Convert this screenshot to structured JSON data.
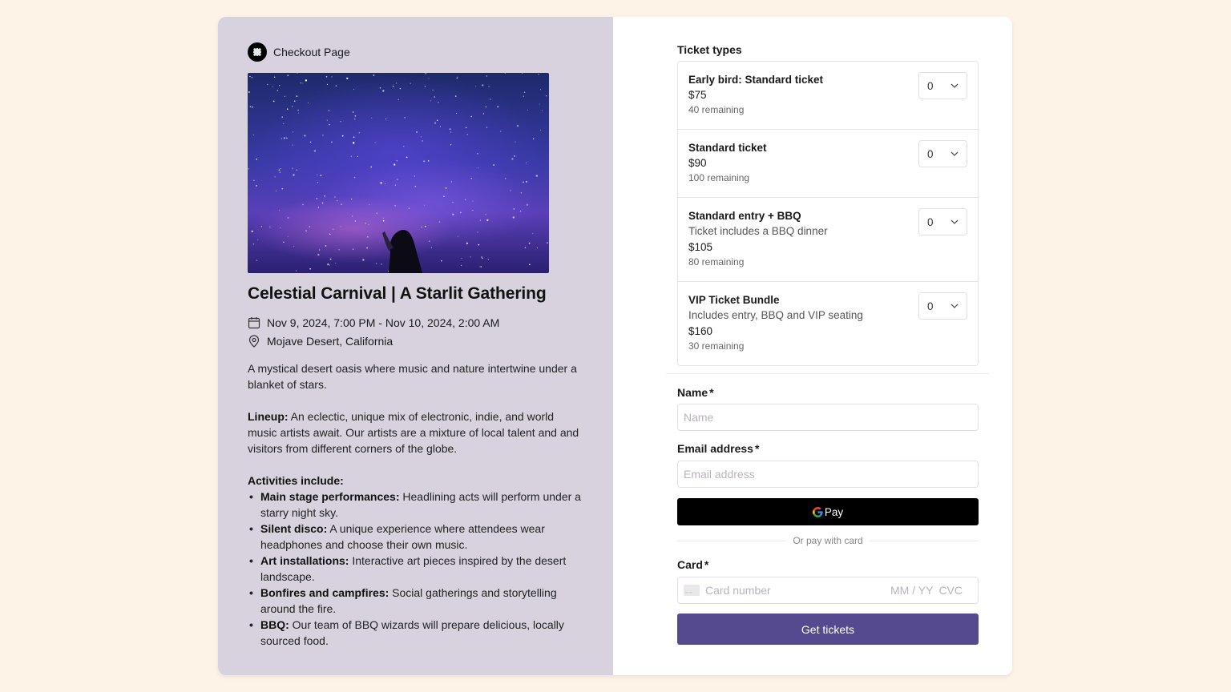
{
  "brand": {
    "name": "Checkout Page",
    "logo_icon": "brand-logo-icon"
  },
  "event": {
    "title": "Celestial Carnival | A Starlit Gathering",
    "datetime": "Nov 9, 2024, 7:00 PM - Nov 10, 2024, 2:00 AM",
    "location": "Mojave Desert, California",
    "intro": "A mystical desert oasis where music and nature intertwine under a blanket of stars.",
    "lineup_label": "Lineup:",
    "lineup_text": " An eclectic, unique mix of electronic, indie, and world music artists await. Our artists are a mixture of local talent and and visitors from different corners of the globe.",
    "activities_label": "Activities include:",
    "activities": [
      {
        "title": "Main stage performances:",
        "text": " Headlining acts will perform under a starry night sky."
      },
      {
        "title": "Silent disco:",
        "text": " A unique experience where attendees wear headphones and choose their own music."
      },
      {
        "title": "Art installations:",
        "text": " Interactive art pieces inspired by the desert landscape."
      },
      {
        "title": "Bonfires and campfires:",
        "text": " Social gatherings and storytelling around the fire."
      },
      {
        "title": "BBQ:",
        "text": " Our team of BBQ wizards will prepare delicious, locally sourced food."
      }
    ]
  },
  "tickets": {
    "label": "Ticket types",
    "items": [
      {
        "name": "Early bird: Standard ticket",
        "description": null,
        "price": "$75",
        "remaining": "40 remaining",
        "quantity": "0"
      },
      {
        "name": "Standard ticket",
        "description": null,
        "price": "$90",
        "remaining": "100 remaining",
        "quantity": "0"
      },
      {
        "name": "Standard entry + BBQ",
        "description": "Ticket includes a BBQ dinner",
        "price": "$105",
        "remaining": "80 remaining",
        "quantity": "0"
      },
      {
        "name": "VIP Ticket Bundle",
        "description": "Includes entry, BBQ and VIP seating",
        "price": "$160",
        "remaining": "30 remaining",
        "quantity": "0"
      }
    ]
  },
  "form": {
    "name_label": "Name",
    "name_placeholder": "Name",
    "name_value": "",
    "email_label": "Email address",
    "email_placeholder": "Email address",
    "email_value": "",
    "required_mark": "*",
    "gpay_label": "Pay",
    "or_label": "Or pay with card",
    "card_label": "Card",
    "card_number_placeholder": "Card number",
    "card_expiry_placeholder": "MM / YY",
    "card_cvc_placeholder": "CVC",
    "submit_label": "Get tickets"
  },
  "colors": {
    "page_bg": "#fdf3e7",
    "left_panel_bg": "#d7d2de",
    "submit_bg": "#554a8f",
    "gpay_bg": "#000000"
  }
}
